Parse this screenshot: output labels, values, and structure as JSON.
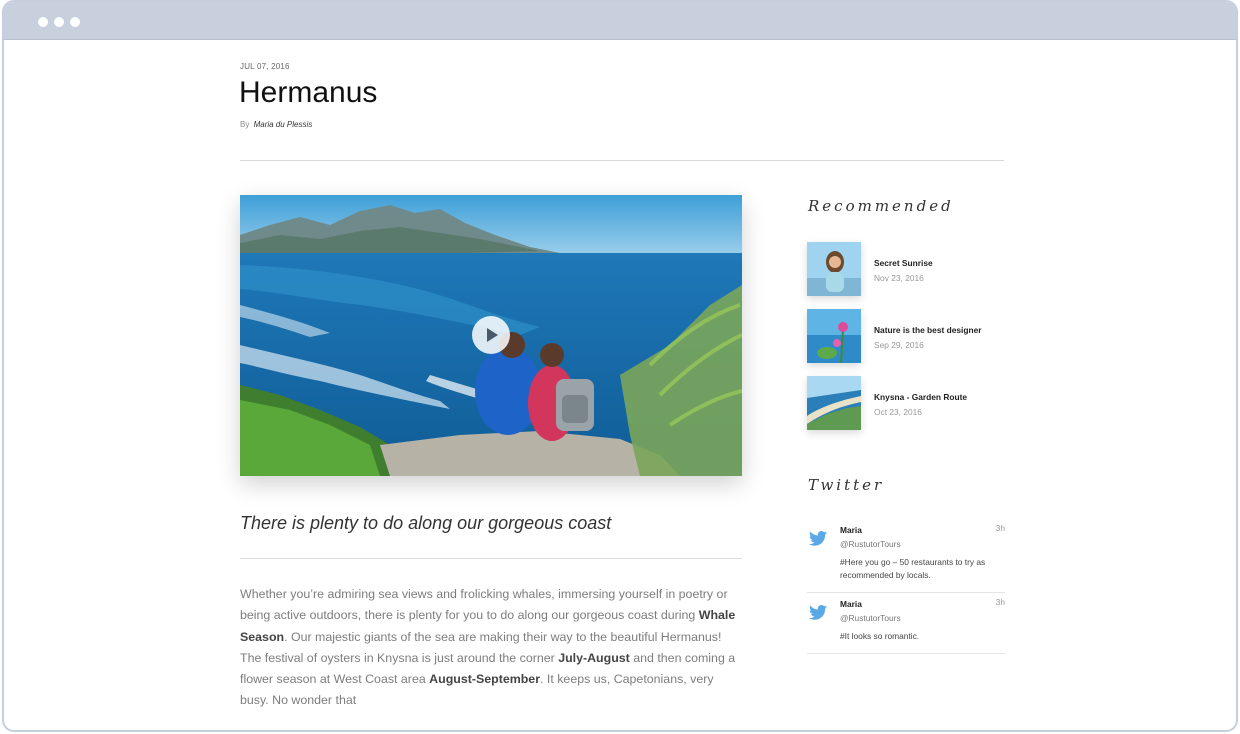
{
  "post": {
    "date": "JUL 07, 2016",
    "title": "Hermanus",
    "by_label": "By",
    "author": "Maria du Plessis",
    "subtitle": "There is plenty to do along our gorgeous coast",
    "body": {
      "p1": "Whether you’re admiring sea views and frolicking whales, immersing yourself in poetry or being active outdoors, there is plenty for you to do along our gorgeous coast during ",
      "b1": "Whale Season",
      "p2": ". Our majestic giants of the sea are making their way to the beautiful Hermanus! The festival of oysters in Knysna is just around the corner ",
      "b2": "July-August",
      "p3": " and then coming a flower season at West Coast area ",
      "b3": "August-September",
      "p4": ". It keeps us, Capetonians, very busy. No wonder that"
    },
    "video_icon": "play-icon"
  },
  "sidebar": {
    "recommended_heading": "Recommended",
    "recommended": [
      {
        "title": "Secret Sunrise",
        "date": "Nov 23, 2016"
      },
      {
        "title": "Nature is the best designer",
        "date": "Sep 29, 2016"
      },
      {
        "title": "Knysna - Garden Route",
        "date": "Oct 23, 2016"
      }
    ],
    "twitter_heading": "Twitter",
    "tweets": [
      {
        "name": "Maria",
        "handle": "@RustutorTours",
        "time": "3h",
        "text": "#Here you go – 50 restaurants to try as recommended by locals."
      },
      {
        "name": "Maria",
        "handle": "@RustutorTours",
        "time": "3h",
        "text": "#It looks so romantic."
      }
    ],
    "twitter_icon": "twitter-bird-icon",
    "twitter_color": "#5aa9e6"
  }
}
